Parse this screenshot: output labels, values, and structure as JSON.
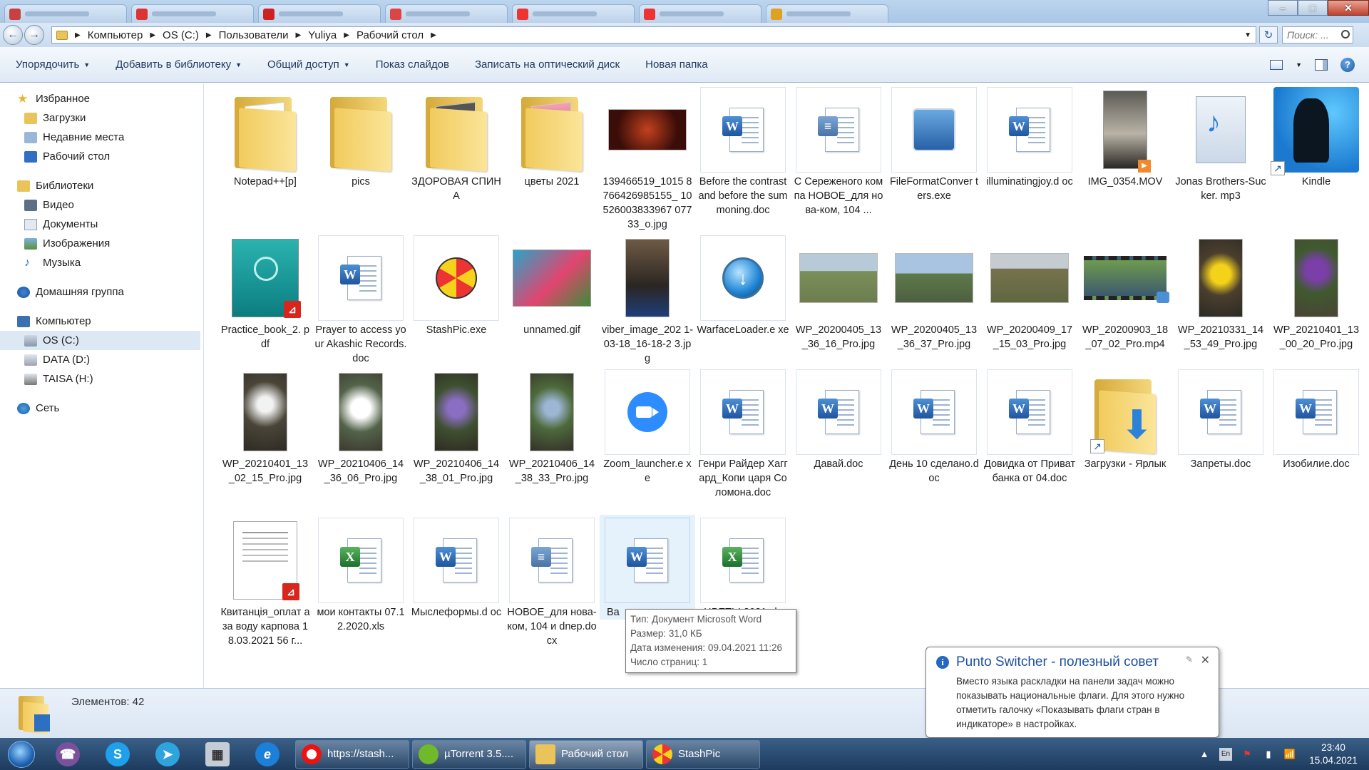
{
  "address": {
    "crumbs": [
      "Компьютер",
      "OS (C:)",
      "Пользователи",
      "Yuliya",
      "Рабочий стол"
    ],
    "search_placeholder": "Поиск: ..."
  },
  "toolbar": {
    "organize": "Упорядочить",
    "add_library": "Добавить в библиотеку",
    "share": "Общий доступ",
    "slideshow": "Показ слайдов",
    "burn": "Записать на оптический диск",
    "new_folder": "Новая папка"
  },
  "sidebar": {
    "favorites": "Избранное",
    "downloads": "Загрузки",
    "recent": "Недавние места",
    "desktop": "Рабочий стол",
    "libraries": "Библиотеки",
    "video": "Видео",
    "documents": "Документы",
    "images": "Изображения",
    "music": "Музыка",
    "homegroup": "Домашняя группа",
    "computer": "Компьютер",
    "drive_c": "OS (C:)",
    "drive_d": "DATA (D:)",
    "drive_h": "TAISA (H:)",
    "network": "Сеть"
  },
  "files": [
    {
      "name": "Notepad++[p]",
      "type": "folder"
    },
    {
      "name": "pics",
      "type": "folder"
    },
    {
      "name": "ЗДОРОВАЯ СПИНА",
      "type": "folder"
    },
    {
      "name": "цветы 2021",
      "type": "folder"
    },
    {
      "name": "139466519_1015 8766426985155_ 10526003833967 07733_o.jpg",
      "type": "image"
    },
    {
      "name": "Before the contrast and before the summoning.doc",
      "type": "word"
    },
    {
      "name": "С Сереженого компа НОВОЕ_для нова-ком, 104 ...",
      "type": "word"
    },
    {
      "name": "FileFormatConver ters.exe",
      "type": "exe"
    },
    {
      "name": "illuminatingjoy.d oc",
      "type": "word"
    },
    {
      "name": "IMG_0354.MOV",
      "type": "video"
    },
    {
      "name": "Jonas Brothers-Sucker. mp3",
      "type": "audio"
    },
    {
      "name": "Kindle",
      "type": "shortcut"
    },
    {
      "name": "Practice_book_2. pdf",
      "type": "pdf"
    },
    {
      "name": "Prayer to access your Akashic Records.doc",
      "type": "word"
    },
    {
      "name": "StashPic.exe",
      "type": "exe"
    },
    {
      "name": "unnamed.gif",
      "type": "image"
    },
    {
      "name": "viber_image_202 1-03-18_16-18-2 3.jpg",
      "type": "image"
    },
    {
      "name": "WarfaceLoader.e xe",
      "type": "exe"
    },
    {
      "name": "WP_20200405_13 _36_16_Pro.jpg",
      "type": "image"
    },
    {
      "name": "WP_20200405_13 _36_37_Pro.jpg",
      "type": "image"
    },
    {
      "name": "WP_20200409_17 _15_03_Pro.jpg",
      "type": "image"
    },
    {
      "name": "WP_20200903_18 _07_02_Pro.mp4",
      "type": "video"
    },
    {
      "name": "WP_20210331_14 _53_49_Pro.jpg",
      "type": "image"
    },
    {
      "name": "WP_20210401_13 _00_20_Pro.jpg",
      "type": "image"
    },
    {
      "name": "WP_20210401_13 _02_15_Pro.jpg",
      "type": "image"
    },
    {
      "name": "WP_20210406_14 _36_06_Pro.jpg",
      "type": "image"
    },
    {
      "name": "WP_20210406_14 _38_01_Pro.jpg",
      "type": "image"
    },
    {
      "name": "WP_20210406_14 _38_33_Pro.jpg",
      "type": "image"
    },
    {
      "name": "Zoom_launcher.e xe",
      "type": "exe"
    },
    {
      "name": "Генри Райдер Хаггард_Копи царя Соломона.doc",
      "type": "word"
    },
    {
      "name": "Давай.doc",
      "type": "word"
    },
    {
      "name": "День 10 сделано.doc",
      "type": "word"
    },
    {
      "name": "Довидка от Приватбанка от 04.doc",
      "type": "word"
    },
    {
      "name": "Загрузки - Ярлык",
      "type": "folder-shortcut"
    },
    {
      "name": "Запреты.doc",
      "type": "word"
    },
    {
      "name": "Изобилие.doc",
      "type": "word"
    },
    {
      "name": "Квитанція_оплат а за воду карпова 18.03.2021 56 г...",
      "type": "pdf"
    },
    {
      "name": "мои контакты 07.12.2020.xls",
      "type": "excel"
    },
    {
      "name": "Мыслеформы.d oc",
      "type": "word"
    },
    {
      "name": "НОВОЕ_для нова-ком, 104 и dnep.docx",
      "type": "word"
    },
    {
      "name": "Ва",
      "type": "word"
    },
    {
      "name": "ЦВЕТЫ 2021.xls",
      "type": "excel"
    }
  ],
  "tooltip": {
    "type": "Тип: Документ Microsoft Word",
    "size": "Размер: 31,0 КБ",
    "modified": "Дата изменения: 09.04.2021 11:26",
    "pages": "Число страниц: 1"
  },
  "status": {
    "count": "Элементов: 42"
  },
  "punto": {
    "title": "Punto Switcher - полезный совет",
    "body": "Вместо языка раскладки на панели задач можно показывать национальные флаги. Для этого нужно отметить галочку «Показывать флаги стран в индикаторе» в настройках."
  },
  "taskbar": {
    "browser": "https://stash...",
    "utorrent": "µTorrent 3.5....",
    "explorer": "Рабочий стол",
    "stashpic": "StashPic",
    "time": "23:40",
    "date": "15.04.2021"
  },
  "colors": {
    "accent": "#1e4f9e",
    "selection": "#dde8f5",
    "taskbar": "#1d3b5e"
  }
}
